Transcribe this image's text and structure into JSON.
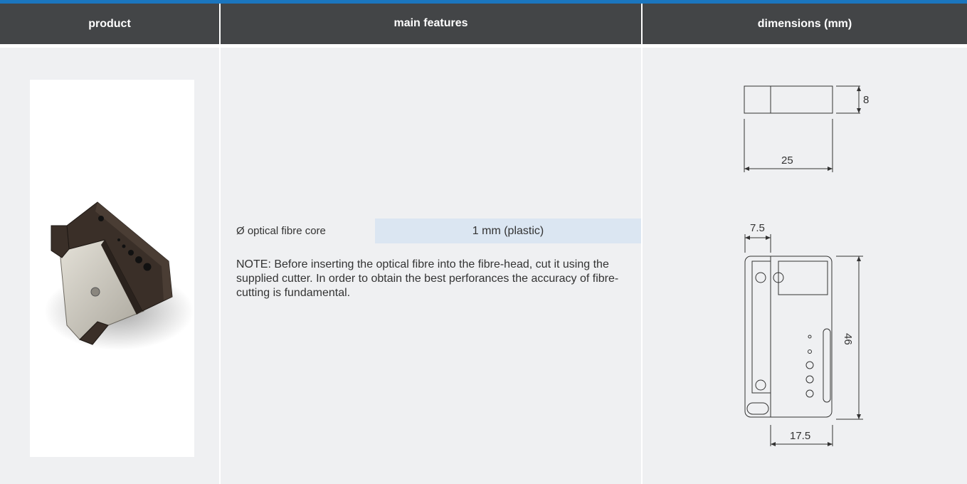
{
  "header": {
    "product": "product",
    "features": "main features",
    "dimensions": "dimensions (mm)"
  },
  "features": {
    "rows": [
      {
        "label": "Ø optical fibre core",
        "value": "1 mm (plastic)"
      }
    ],
    "note": "NOTE: Before inserting the optical fibre into the fibre-head, cut it using the supplied cutter. In order to obtain the best perforances the accuracy of fibre-cutting is fundamental."
  },
  "dimensions": {
    "top_view_height": "8",
    "top_view_width": "25",
    "front_offset": "7.5",
    "front_height": "46",
    "front_width": "17.5"
  },
  "colors": {
    "accent_rule": "#1b76bf",
    "header_bg": "#434547",
    "cell_bg": "#eff0f2",
    "value_bg": "#dbe6f2"
  },
  "icons": {
    "product_image": "fibre-cutter-photo"
  }
}
